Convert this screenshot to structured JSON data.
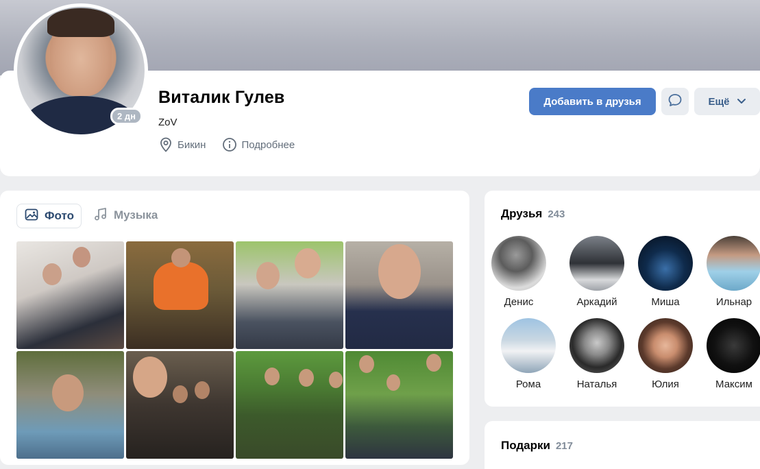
{
  "profile": {
    "name": "Виталик Гулев",
    "status": "ZoV",
    "online_badge": "2 дн",
    "city": "Бикин",
    "details_label": "Подробнее"
  },
  "actions": {
    "add_friend": "Добавить в друзья",
    "more": "Ещё"
  },
  "media_tabs": {
    "photo": "Фото",
    "music": "Музыка"
  },
  "friends": {
    "title": "Друзья",
    "count": "243",
    "items": [
      {
        "name": "Денис"
      },
      {
        "name": "Аркадий"
      },
      {
        "name": "Миша"
      },
      {
        "name": "Ильнар"
      },
      {
        "name": "Рома"
      },
      {
        "name": "Наталья"
      },
      {
        "name": "Юлия"
      },
      {
        "name": "Максим"
      }
    ]
  },
  "gifts": {
    "title": "Подарки",
    "count": "217"
  },
  "colors": {
    "accent": "#4a7bc8",
    "background": "#edeef0",
    "muted_text": "#818c99"
  },
  "icons": [
    "location-pin-icon",
    "info-icon",
    "message-icon",
    "chevron-down-icon",
    "photo-icon",
    "music-note-icon"
  ]
}
